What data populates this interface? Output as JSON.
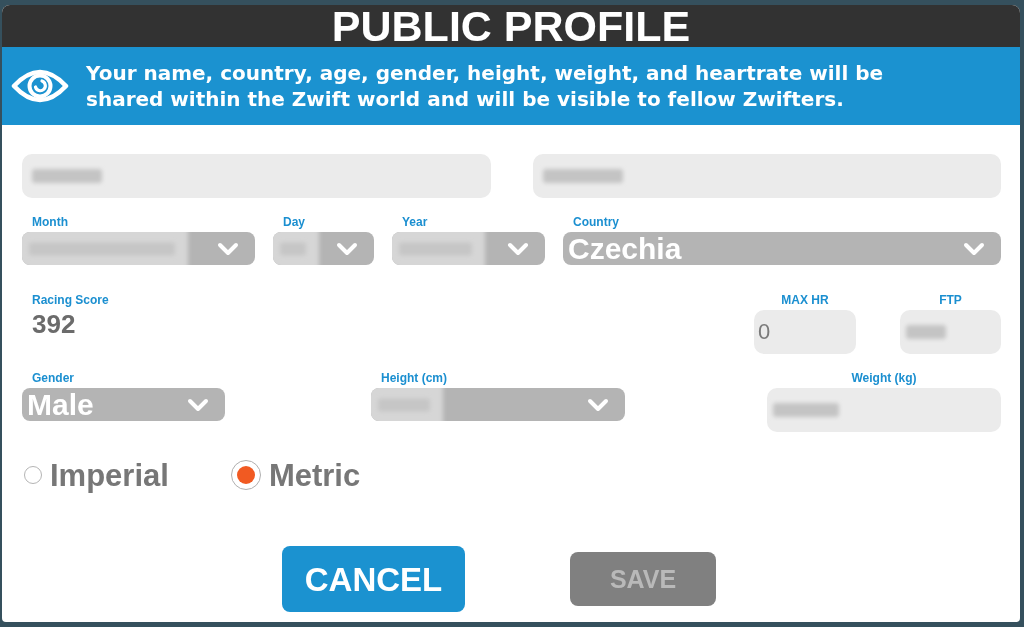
{
  "dialog": {
    "title": "PUBLIC PROFILE"
  },
  "notice": {
    "text": "Your name, country, age, gender, height, weight, and heartrate will be shared within the Zwift world and will be visible to fellow Zwifters."
  },
  "name_fields": [
    {
      "kind": "text",
      "redacted": true
    },
    {
      "kind": "text",
      "redacted": true
    }
  ],
  "birth_country_row": [
    {
      "label": "Month",
      "kind": "dropdown",
      "redacted": true
    },
    {
      "label": "Day",
      "kind": "dropdown",
      "redacted": true
    },
    {
      "label": "Year",
      "kind": "dropdown",
      "redacted": true
    },
    {
      "label": "Country",
      "kind": "dropdown",
      "value": "Czechia"
    }
  ],
  "racing_score": {
    "label": "Racing Score",
    "value": "392"
  },
  "heart_power_fields": [
    {
      "label": "MAX HR",
      "kind": "text",
      "value": "0"
    },
    {
      "label": "FTP",
      "kind": "text",
      "redacted": true
    }
  ],
  "body_fields": [
    {
      "label": "Gender",
      "kind": "dropdown",
      "value": "Male"
    },
    {
      "label": "Height (cm)",
      "kind": "dropdown",
      "redacted": true
    },
    {
      "label": "Weight (kg)",
      "kind": "text",
      "redacted": true
    }
  ],
  "units": [
    {
      "label": "Imperial",
      "selected": false
    },
    {
      "label": "Metric",
      "selected": true
    }
  ],
  "buttons": [
    {
      "label": "CANCEL",
      "disabled": false
    },
    {
      "label": "SAVE",
      "disabled": true
    }
  ]
}
